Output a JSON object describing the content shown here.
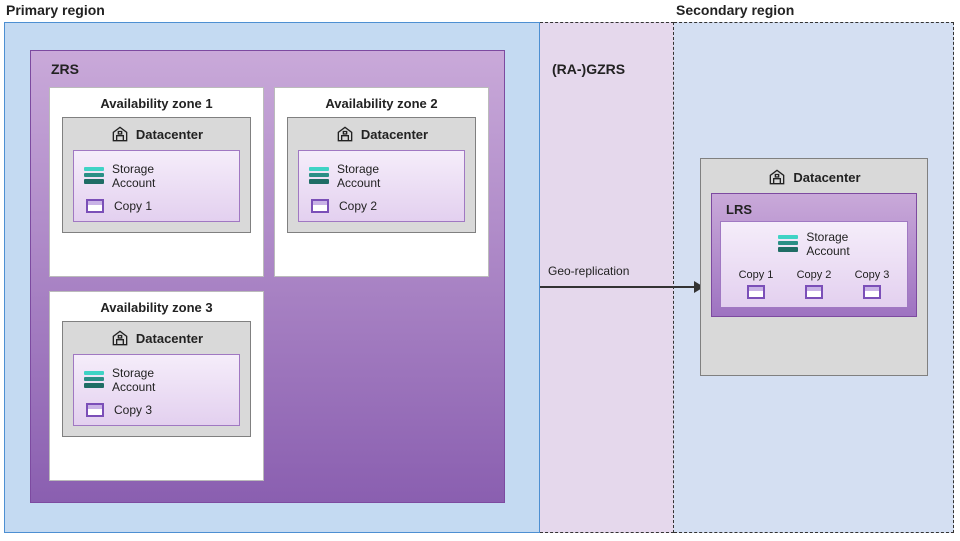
{
  "regions": {
    "primary": "Primary region",
    "secondary": "Secondary region"
  },
  "gzrs": "(RA-)GZRS",
  "zrs_label": "ZRS",
  "zones": [
    {
      "title": "Availability zone 1",
      "dc": "Datacenter",
      "storage": "Storage\nAccount",
      "copy": "Copy 1"
    },
    {
      "title": "Availability zone 2",
      "dc": "Datacenter",
      "storage": "Storage\nAccount",
      "copy": "Copy 2"
    },
    {
      "title": "Availability zone 3",
      "dc": "Datacenter",
      "storage": "Storage\nAccount",
      "copy": "Copy 3"
    }
  ],
  "arrow_label": "Geo-replication",
  "secondary_dc": {
    "dc": "Datacenter",
    "lrs": "LRS",
    "storage": "Storage\nAccount",
    "copies": [
      "Copy 1",
      "Copy 2",
      "Copy 3"
    ]
  }
}
